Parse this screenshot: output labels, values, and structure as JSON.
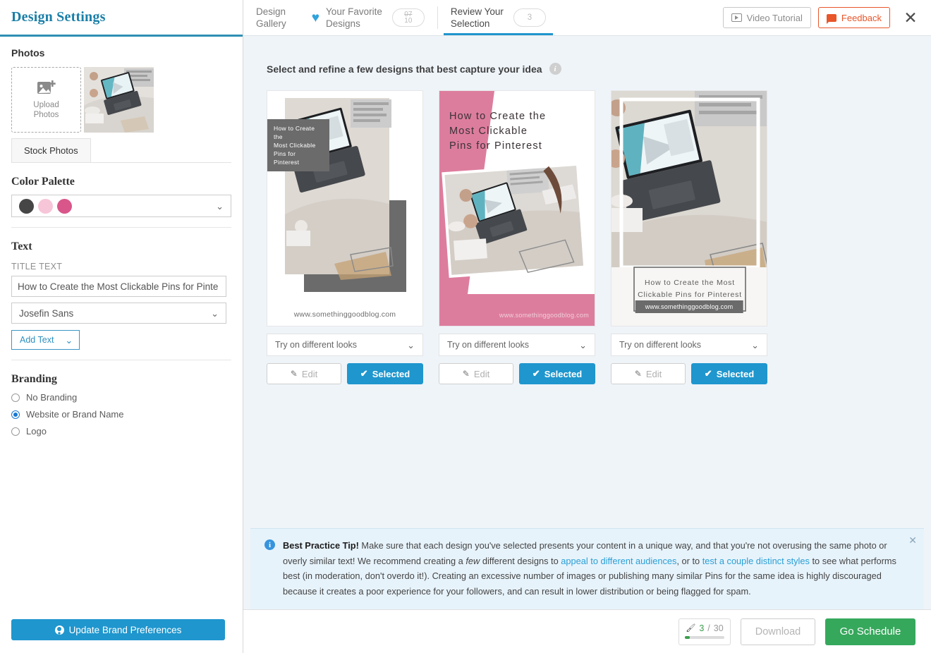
{
  "sidebar": {
    "title": "Design Settings",
    "photos": {
      "heading": "Photos",
      "upload_label": "Upload\nPhotos",
      "stock_tab": "Stock Photos"
    },
    "color_palette": {
      "heading": "Color Palette",
      "swatches": [
        "#464646",
        "#f7c5d8",
        "#d9568a"
      ]
    },
    "text": {
      "heading": "Text",
      "title_label": "TITLE TEXT",
      "title_value": "How to Create the Most Clickable Pins for Pinte",
      "font_value": "Josefin Sans",
      "add_text_label": "Add Text"
    },
    "branding": {
      "heading": "Branding",
      "options": [
        {
          "label": "No Branding",
          "selected": false
        },
        {
          "label": "Website or Brand Name",
          "selected": true
        },
        {
          "label": "Logo",
          "selected": false
        }
      ]
    },
    "update_brand_button": "Update Brand Preferences"
  },
  "topbar": {
    "tabs": [
      {
        "label": "Design\nGallery",
        "active": false,
        "badge": null
      },
      {
        "label": "Your Favorite\nDesigns",
        "active": false,
        "badge": "07\n10"
      },
      {
        "label": "Review Your\nSelection",
        "active": true,
        "badge": "3"
      }
    ],
    "badge_favorites_num": "07",
    "badge_favorites_den": "10",
    "badge_review": "3",
    "video_tutorial": "Video Tutorial",
    "feedback": "Feedback",
    "close": "✕",
    "accent_blue": "#1f96cd",
    "feedback_color": "#e8562a"
  },
  "main": {
    "instruction": "Select and refine a few designs that best capture your idea",
    "info_icon": "i",
    "cards": [
      {
        "style": "overlay-left",
        "title": "How to Create the\nMost Clickable\nPins for Pinterest",
        "url": "www.somethinggoodblog.com",
        "look_label": "Try on different looks",
        "edit_label": "Edit",
        "selected_label": "Selected"
      },
      {
        "style": "pink-diagonal",
        "title": "How to Create the\nMost Clickable\nPins for Pinterest",
        "url": "www.somethinggoodblog.com",
        "look_label": "Try on different looks",
        "edit_label": "Edit",
        "selected_label": "Selected"
      },
      {
        "style": "framed-bottom",
        "title": "How to Create the Most\nClickable Pins for Pinterest",
        "url": "www.somethinggoodblog.com",
        "look_label": "Try on different looks",
        "edit_label": "Edit",
        "selected_label": "Selected"
      }
    ]
  },
  "tip": {
    "label": "Best Practice Tip!",
    "part1": " Make sure that each design you've selected presents your content in a unique way, and that you're not overusing the same photo or overly similar text! We recommend creating a ",
    "emphasis": "few",
    "part2": " different designs to ",
    "link1": "appeal to different audiences",
    "part3": ", or to ",
    "link2": "test a couple distinct styles",
    "part4": " to see what performs best (in moderation, don't overdo it!). Creating an excessive number of images or publishing many similar Pins for the same idea is highly discouraged because it creates a poor experience for your followers, and can result in lower distribution or being flagged for spam.",
    "close": "✕"
  },
  "bottombar": {
    "counter_current": "3",
    "counter_separator": "/",
    "counter_total": "30",
    "brush_icon": "brush-icon",
    "download_label": "Download",
    "schedule_label": "Go Schedule",
    "schedule_color": "#36a85c"
  }
}
